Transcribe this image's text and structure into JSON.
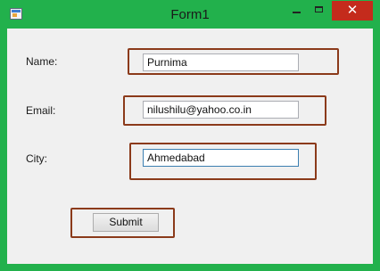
{
  "window": {
    "title": "Form1",
    "controls": {
      "minimize": "–",
      "maximize": "□",
      "close": "✕"
    }
  },
  "form": {
    "name_label": "Name:",
    "name_value": "Purnima",
    "email_label": "Email:",
    "email_value": "nilushilu@yahoo.co.in",
    "city_label": "City:",
    "city_value": "Ahmedabad",
    "submit_label": "Submit"
  },
  "colors": {
    "frame": "#22b14c",
    "close_button": "#c42b1c",
    "highlight_outline": "#8b3a1a"
  },
  "icons": [
    "app-icon",
    "minimize-icon",
    "maximize-icon",
    "close-icon"
  ]
}
